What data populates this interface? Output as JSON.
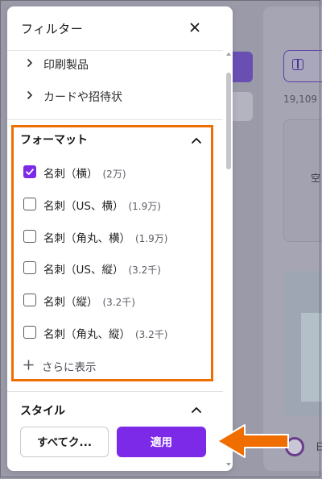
{
  "background": {
    "result_count": "19,109",
    "tile_text": "空",
    "logo_text": "日"
  },
  "panel": {
    "title": "フィルター",
    "categories": [
      {
        "label": "印刷製品"
      },
      {
        "label": "カードや招待状"
      }
    ],
    "format_section": {
      "title": "フォーマット",
      "options": [
        {
          "label": "名刺（横）",
          "count": "(2万)",
          "checked": true
        },
        {
          "label": "名刺（US、横）",
          "count": "(1.9万)",
          "checked": false
        },
        {
          "label": "名刺（角丸、横）",
          "count": "(1.9万)",
          "checked": false
        },
        {
          "label": "名刺（US、縦）",
          "count": "(3.2千)",
          "checked": false
        },
        {
          "label": "名刺（縦）",
          "count": "(3.2千)",
          "checked": false
        },
        {
          "label": "名刺（角丸、縦）",
          "count": "(3.2千)",
          "checked": false
        }
      ],
      "show_more": "さらに表示"
    },
    "style_section": {
      "title": "スタイル"
    },
    "footer": {
      "clear_label": "すべてク...",
      "apply_label": "適用"
    }
  },
  "colors": {
    "accent": "#7d2ae8",
    "highlight": "#f06e00"
  }
}
